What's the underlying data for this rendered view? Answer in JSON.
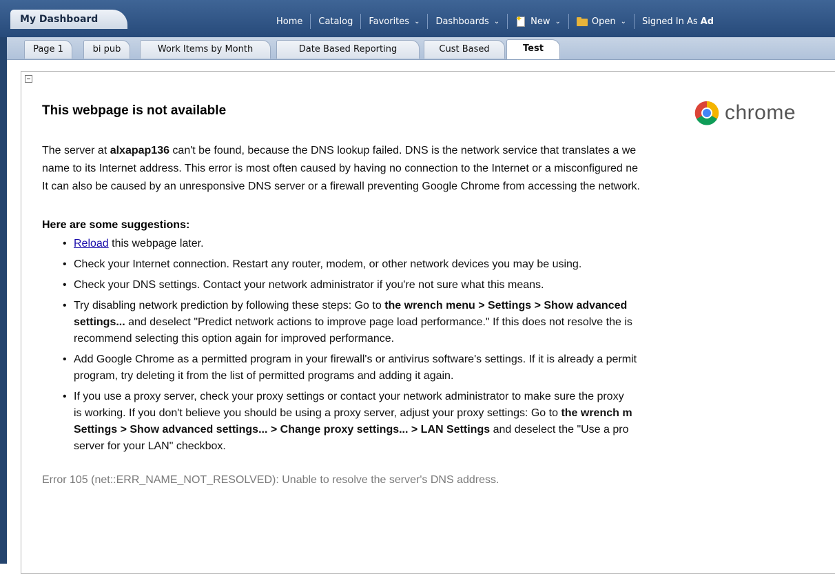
{
  "header": {
    "dashboard_tab": "My Dashboard",
    "nav": {
      "home": "Home",
      "catalog": "Catalog",
      "favorites": "Favorites",
      "dashboards": "Dashboards",
      "new": "New",
      "open": "Open",
      "signed_in_prefix": "Signed In As",
      "signed_in_user": "Ad"
    }
  },
  "tabs": [
    "Page 1",
    "bi pub",
    "Work Items by Month",
    "Date Based Reporting",
    "Cust Based",
    "Test"
  ],
  "active_tab": "Test",
  "error_page": {
    "title": "This webpage is not available",
    "logo_text": "chrome",
    "para": {
      "l1_a": "The server at ",
      "l1_host": "alxapap136",
      "l1_b": " can't be found, because the DNS lookup failed. DNS is the network service that translates a we",
      "l2": "name to its Internet address. This error is most often caused by having no connection to the Internet or a misconfigured ne",
      "l3": "It can also be caused by an unresponsive DNS server or a firewall preventing Google Chrome from accessing the network."
    },
    "suggestions_heading": "Here are some suggestions:",
    "suggestions": {
      "s1_link": "Reload",
      "s1_rest": " this webpage later.",
      "s2": "Check your Internet connection. Restart any router, modem, or other network devices you may be using.",
      "s3": "Check your DNS settings. Contact your network administrator if you're not sure what this means.",
      "s4_l1_a": "Try disabling network prediction by following these steps: Go to ",
      "s4_l1_b": "the wrench menu > Settings > Show advanced",
      "s4_l2_a": "settings...",
      "s4_l2_b": " and deselect \"Predict network actions to improve page load performance.\" If this does not resolve the is",
      "s4_l3": "recommend selecting this option again for improved performance.",
      "s5_l1": "Add Google Chrome as a permitted program in your firewall's or antivirus software's settings. If it is already a permit",
      "s5_l2": "program, try deleting it from the list of permitted programs and adding it again.",
      "s6_l1": "If you use a proxy server, check your proxy settings or contact your network administrator to make sure the proxy",
      "s6_l2_a": "is working. If you don't believe you should be using a proxy server, adjust your proxy settings: Go to ",
      "s6_l2_b": "the wrench m",
      "s6_l3_a": "Settings > Show advanced settings... > Change proxy settings... > LAN Settings",
      "s6_l3_b": " and deselect the \"Use a pro",
      "s6_l4": "server for your LAN\" checkbox."
    },
    "error_code": "Error 105 (net::ERR_NAME_NOT_RESOLVED): Unable to resolve the server's DNS address."
  },
  "colors": {
    "topbar": "#2f5585",
    "tabs_bg": "#c2d0e2",
    "link": "#1a0dab",
    "error_code": "#7a7a7a"
  }
}
